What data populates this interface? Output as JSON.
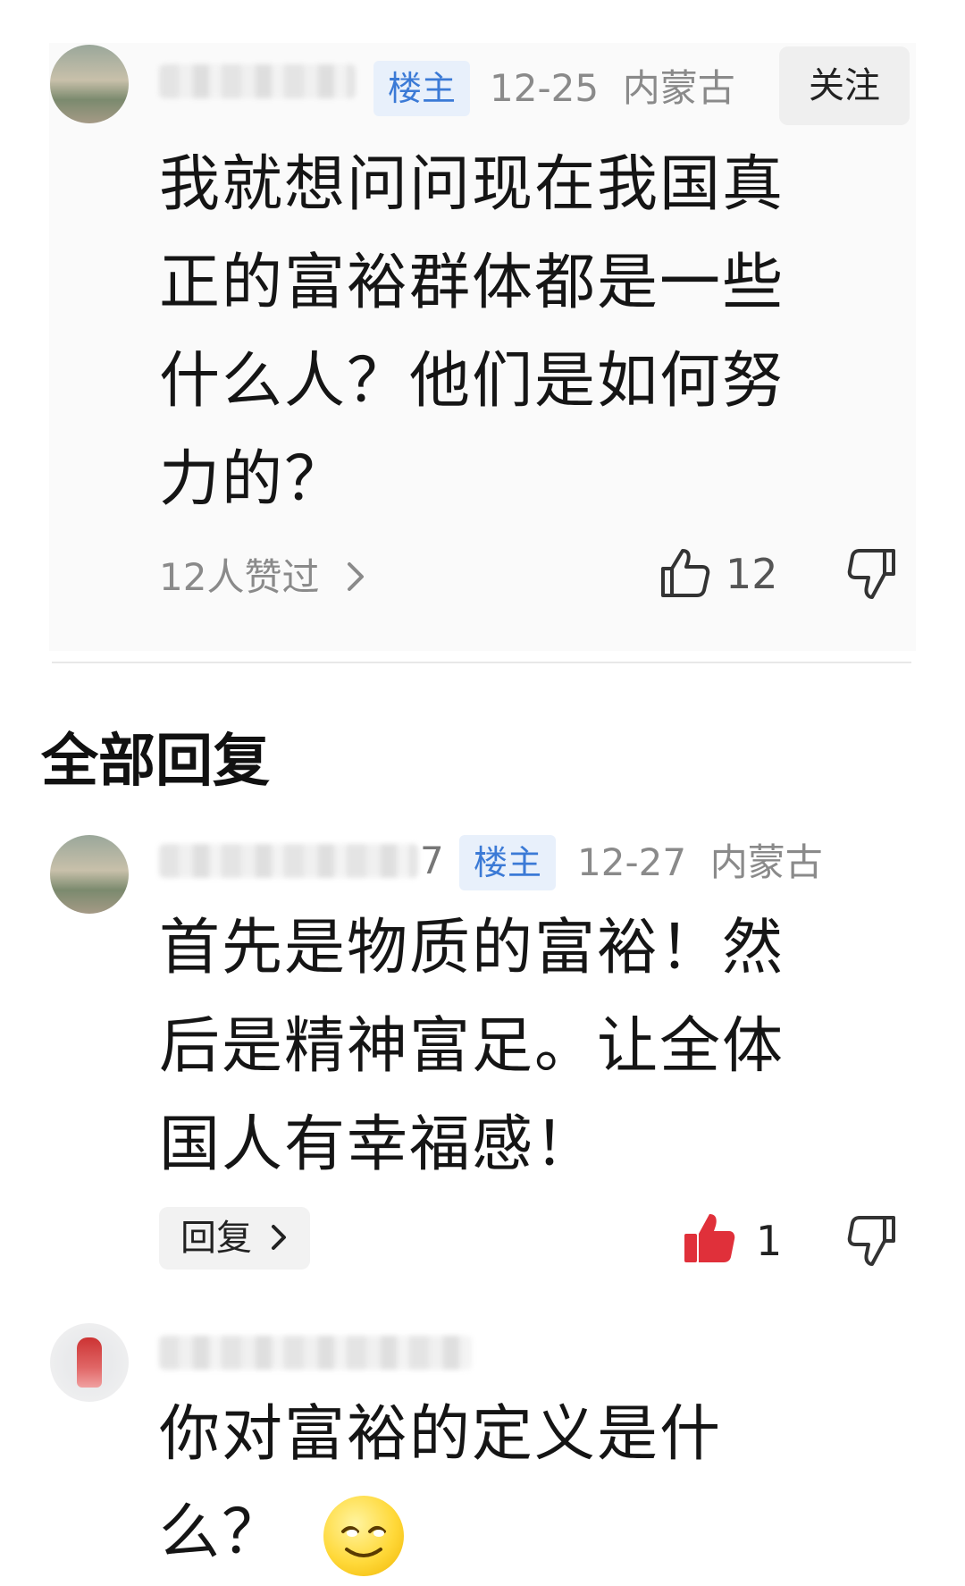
{
  "post": {
    "tag": "楼主",
    "date": "12-25",
    "location": "内蒙古",
    "follow_label": "关注",
    "content_lines": [
      "我就想问问现在我国真",
      "正的富裕群体都是一些",
      "什么人？他们是如何努",
      "力的？"
    ],
    "likes_text": "12人赞过",
    "like_count": "12"
  },
  "section_title": "全部回复",
  "replies": [
    {
      "name_suffix": "7",
      "tag": "楼主",
      "date": "12-27",
      "location": "内蒙古",
      "content_lines": [
        "首先是物质的富裕！然",
        "后是精神富足。让全体",
        "国人有幸福感！"
      ],
      "reply_label": "回复",
      "like_count": "1",
      "liked": true
    },
    {
      "content_lines": [
        "你对富裕的定义是什",
        "么？"
      ]
    }
  ],
  "colors": {
    "accent": "#3b7ad6",
    "liked": "#e0303a"
  },
  "icons": [
    "thumbs-up-icon",
    "thumbs-down-icon",
    "chevron-right-icon",
    "smile-emoji-icon"
  ]
}
